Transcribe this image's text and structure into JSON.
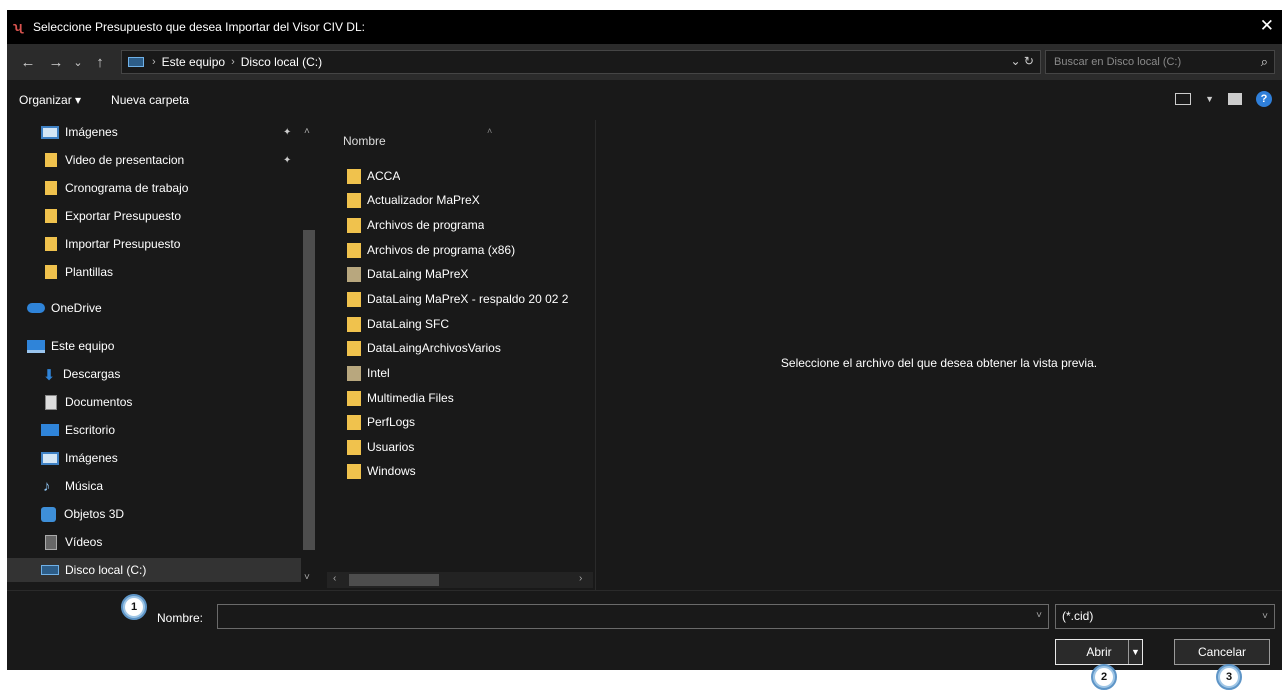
{
  "dialog": {
    "title": "Seleccione Presupuesto que desea Importar del Visor CIV DL:",
    "close_glyph": "✕"
  },
  "nav": {
    "back_glyph": "←",
    "forward_glyph": "→",
    "recent_glyph": "⌄",
    "up_glyph": "↑",
    "breadcrumb": [
      "Este equipo",
      "Disco local (C:)"
    ],
    "refresh_glyph": "⌄ ↻",
    "search_placeholder": "Buscar en Disco local (C:)",
    "search_glyph": "⌕"
  },
  "toolbar": {
    "organize": "Organizar ▾",
    "new_folder": "Nueva carpeta",
    "help": "?"
  },
  "sidebar": {
    "items": [
      {
        "label": "Imágenes",
        "icon": "pictures-icon",
        "pinned": true
      },
      {
        "label": "Video de presentacion",
        "icon": "folder-icon",
        "pinned": true
      },
      {
        "label": "Cronograma de trabajo",
        "icon": "folder-icon"
      },
      {
        "label": "Exportar Presupuesto",
        "icon": "folder-icon"
      },
      {
        "label": "Importar Presupuesto",
        "icon": "folder-icon"
      },
      {
        "label": "Plantillas",
        "icon": "folder-icon"
      },
      {
        "label": "OneDrive",
        "icon": "onedrive-icon"
      },
      {
        "label": "Este equipo",
        "icon": "computer-icon"
      },
      {
        "label": "Descargas",
        "icon": "downloads-icon"
      },
      {
        "label": "Documentos",
        "icon": "documents-icon"
      },
      {
        "label": "Escritorio",
        "icon": "desktop-icon"
      },
      {
        "label": "Imágenes",
        "icon": "pictures-icon"
      },
      {
        "label": "Música",
        "icon": "music-icon"
      },
      {
        "label": "Objetos 3D",
        "icon": "objects3d-icon"
      },
      {
        "label": "Vídeos",
        "icon": "videos-icon"
      },
      {
        "label": "Disco local (C:)",
        "icon": "drive-icon",
        "selected": true
      }
    ]
  },
  "filelist": {
    "column_header": "Nombre",
    "files": [
      "ACCA",
      "Actualizador MaPreX",
      "Archivos de programa",
      "Archivos de programa (x86)",
      "DataLaing MaPreX",
      "DataLaing MaPreX - respaldo 20 02 2",
      "DataLaing SFC",
      "DataLaingArchivosVarios",
      "Intel",
      "Multimedia Files",
      "PerfLogs",
      "Usuarios",
      "Windows"
    ]
  },
  "preview": {
    "message": "Seleccione el archivo del que desea obtener la vista previa."
  },
  "bottom": {
    "name_label": "Nombre:",
    "name_value": "",
    "file_type": "(*.cid)",
    "open_label": "Abrir",
    "cancel_label": "Cancelar"
  },
  "badges": [
    "1",
    "2",
    "3"
  ],
  "colors": {
    "background": "#191919",
    "titlebar": "#000000",
    "folder": "#f0c24d",
    "accent": "#2f84d9",
    "badge": "#9fc6e6"
  }
}
